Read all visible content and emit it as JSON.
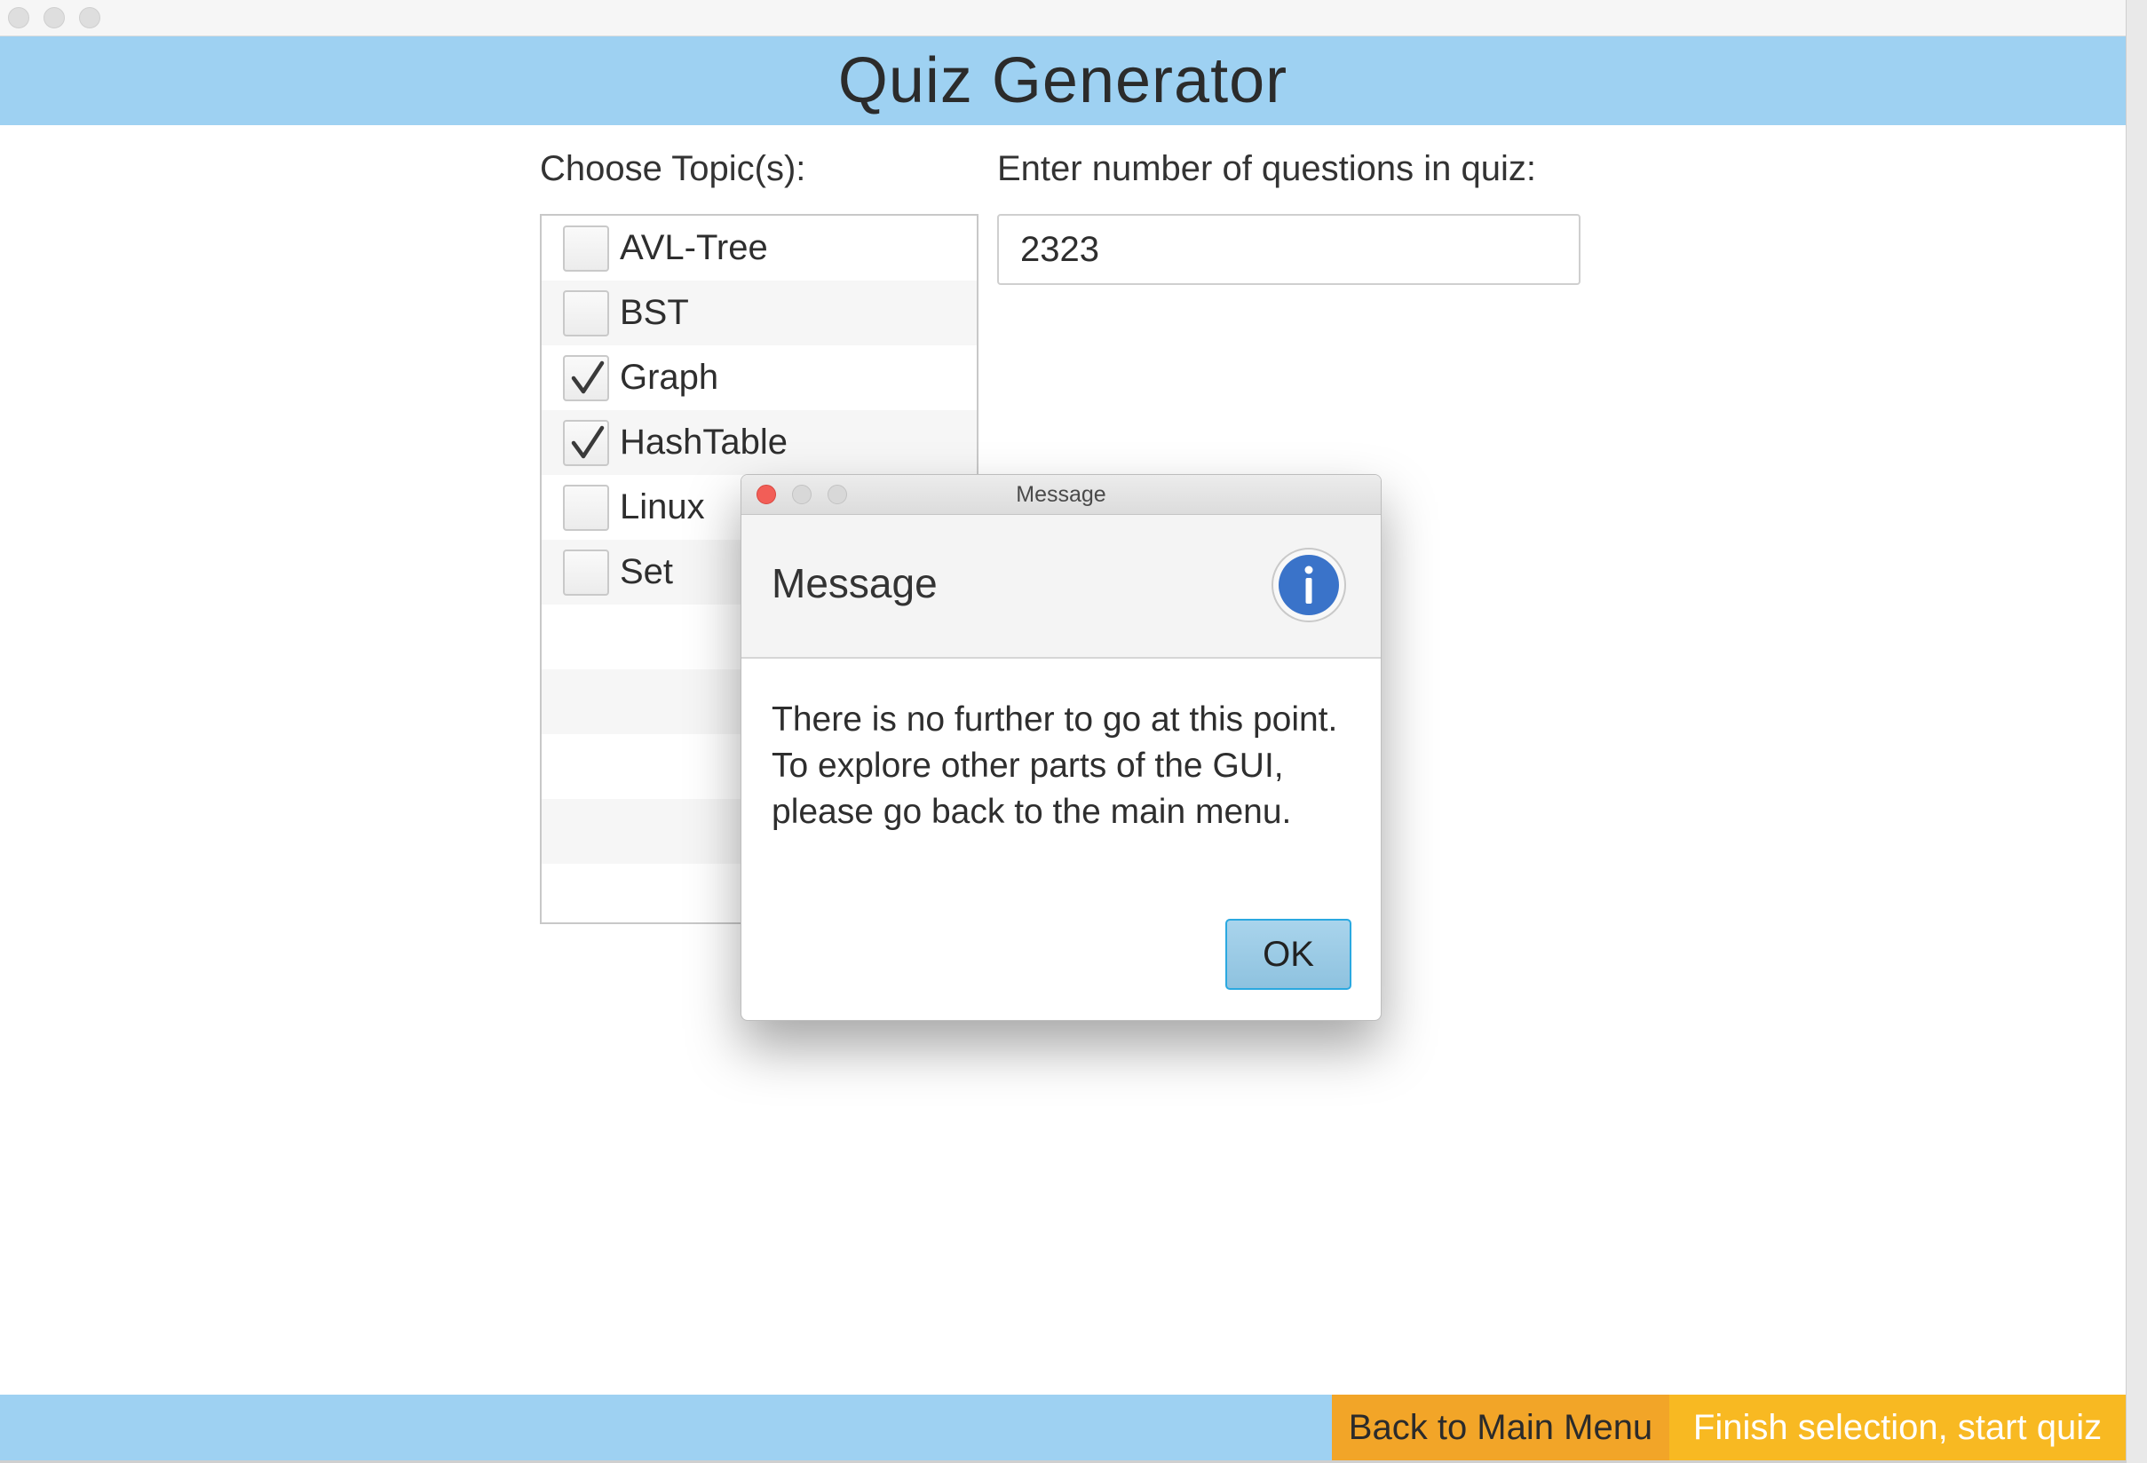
{
  "window": {
    "controls": [
      "close",
      "minimize",
      "zoom"
    ]
  },
  "header": {
    "title": "Quiz Generator"
  },
  "topics": {
    "label": "Choose Topic(s):",
    "items": [
      {
        "label": "AVL-Tree",
        "checked": false
      },
      {
        "label": "BST",
        "checked": false
      },
      {
        "label": "Graph",
        "checked": true
      },
      {
        "label": "HashTable",
        "checked": true
      },
      {
        "label": "Linux",
        "checked": false
      },
      {
        "label": "Set",
        "checked": false
      }
    ]
  },
  "question_count": {
    "label": "Enter number of questions in quiz:",
    "value": "2323"
  },
  "dialog": {
    "window_title": "Message",
    "heading": "Message",
    "icon": "info-icon",
    "body": "There is no further to go at this point. To explore other parts of the GUI, please go back to the main menu.",
    "ok_label": "OK"
  },
  "footer": {
    "back_label": "Back to Main Menu",
    "finish_label": "Finish selection, start quiz"
  },
  "colors": {
    "header_bg": "#9ed1f2",
    "back_button": "#f2a528",
    "finish_button": "#f8b922",
    "dialog_close": "#f25e57",
    "info_blue": "#3a73c9"
  }
}
